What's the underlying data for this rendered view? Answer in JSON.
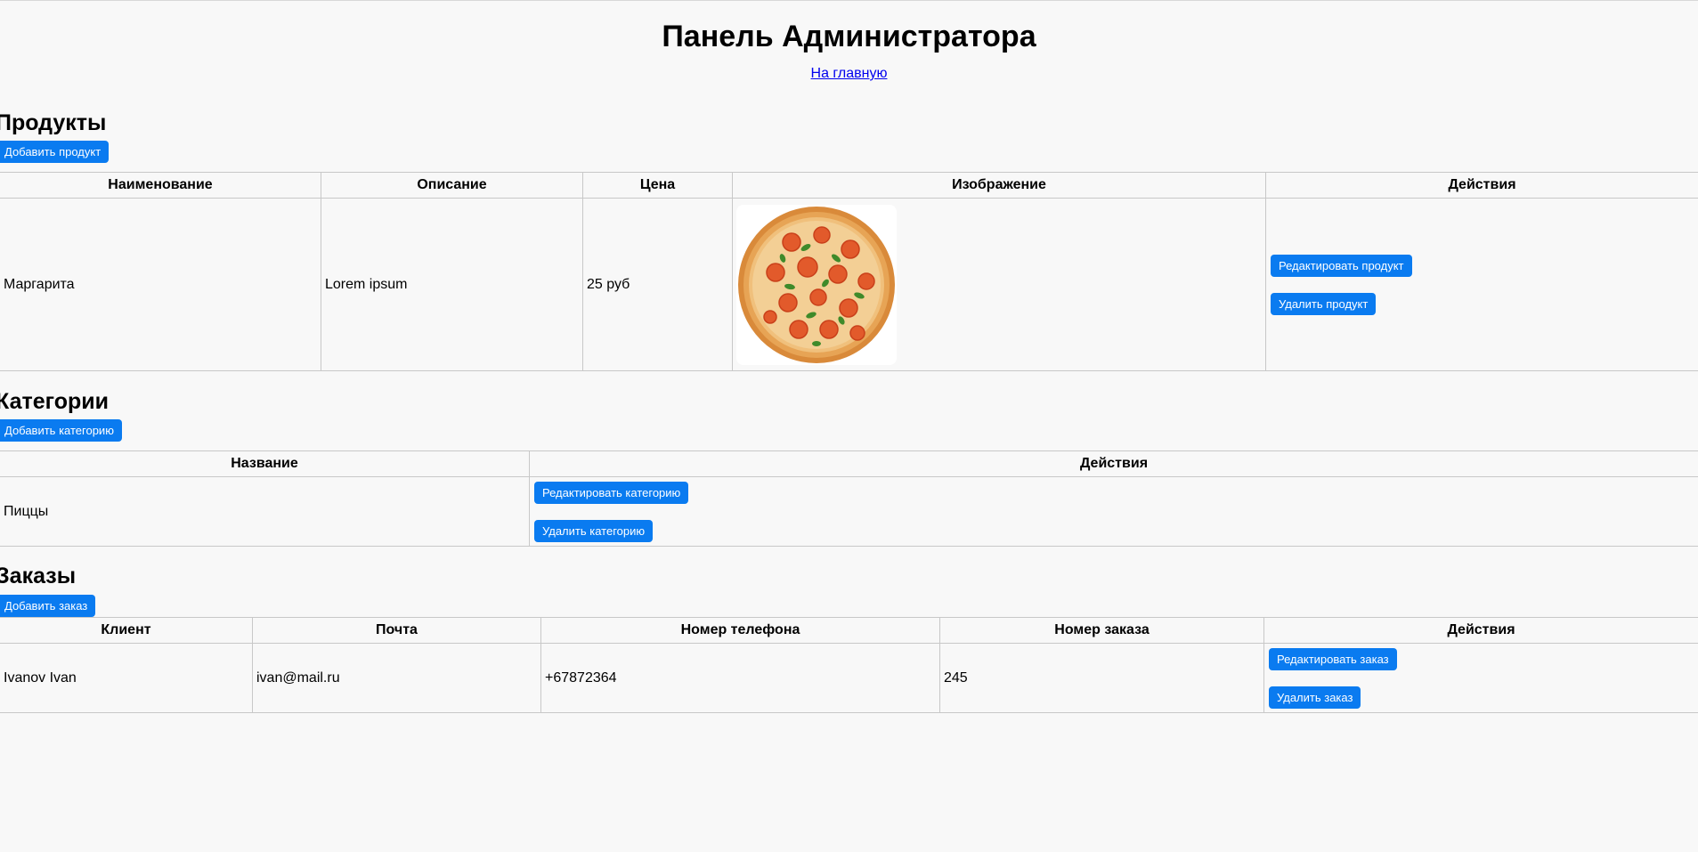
{
  "page": {
    "title": "Панель Администратора",
    "home_link": "На главную"
  },
  "products": {
    "title": "Продукты",
    "add_button": "Добавить продукт",
    "columns": [
      "Наименование",
      "Описание",
      "Цена",
      "Изображение",
      "Действия"
    ],
    "rows": [
      {
        "name": "Маргарита",
        "description": "Lorem ipsum",
        "price": "25 руб",
        "image": "pizza-margherita-image",
        "edit_label": "Редактировать продукт",
        "delete_label": "Удалить продукт"
      }
    ]
  },
  "categories": {
    "title": "Категории",
    "add_button": "Добавить категорию",
    "columns": [
      "Название",
      "Действия"
    ],
    "rows": [
      {
        "name": "Пиццы",
        "edit_label": "Редактировать категорию",
        "delete_label": "Удалить категорию"
      }
    ]
  },
  "orders": {
    "title": "Заказы",
    "add_button": "Добавить заказ",
    "columns": [
      "Клиент",
      "Почта",
      "Номер телефона",
      "Номер заказа",
      "Действия"
    ],
    "rows": [
      {
        "client": "Ivanov Ivan",
        "email": "ivan@mail.ru",
        "phone": "+67872364",
        "order_number": "245",
        "edit_label": "Редактировать заказ",
        "delete_label": "Удалить заказ"
      }
    ]
  },
  "colors": {
    "background": "#f8f8f8",
    "button": "#0a7bf0",
    "link": "#0000ee",
    "border": "#c8c8c8"
  }
}
